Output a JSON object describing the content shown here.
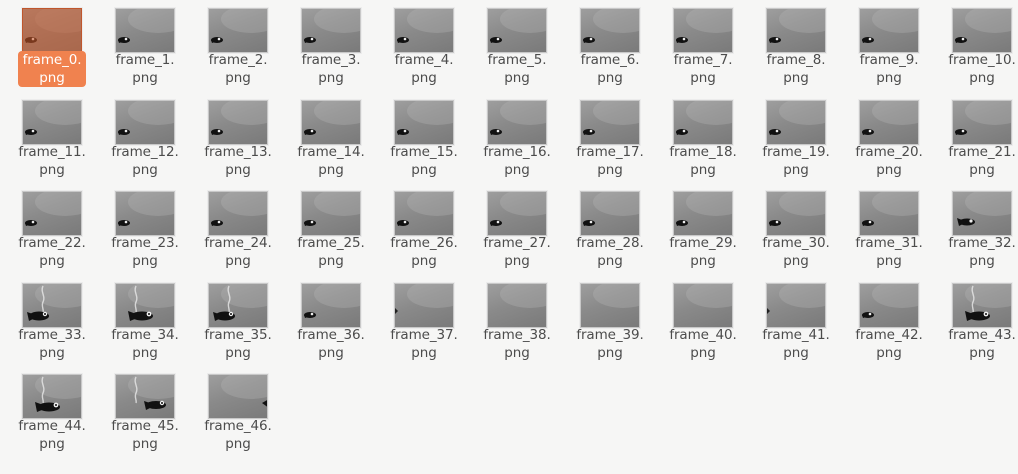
{
  "files": [
    {
      "name": "frame_0.",
      "ext": "png",
      "bird": "small-left",
      "selected": true
    },
    {
      "name": "frame_1.",
      "ext": "png",
      "bird": "small-left"
    },
    {
      "name": "frame_2.",
      "ext": "png",
      "bird": "small-left"
    },
    {
      "name": "frame_3.",
      "ext": "png",
      "bird": "small-left"
    },
    {
      "name": "frame_4.",
      "ext": "png",
      "bird": "small-left"
    },
    {
      "name": "frame_5.",
      "ext": "png",
      "bird": "small-left"
    },
    {
      "name": "frame_6.",
      "ext": "png",
      "bird": "small-left"
    },
    {
      "name": "frame_7.",
      "ext": "png",
      "bird": "small-left"
    },
    {
      "name": "frame_8.",
      "ext": "png",
      "bird": "small-left"
    },
    {
      "name": "frame_9.",
      "ext": "png",
      "bird": "small-left"
    },
    {
      "name": "frame_10.",
      "ext": "png",
      "bird": "small-left"
    },
    {
      "name": "frame_11.",
      "ext": "png",
      "bird": "small-left"
    },
    {
      "name": "frame_12.",
      "ext": "png",
      "bird": "small-left"
    },
    {
      "name": "frame_13.",
      "ext": "png",
      "bird": "small-left"
    },
    {
      "name": "frame_14.",
      "ext": "png",
      "bird": "small-left"
    },
    {
      "name": "frame_15.",
      "ext": "png",
      "bird": "small-left"
    },
    {
      "name": "frame_16.",
      "ext": "png",
      "bird": "small-left"
    },
    {
      "name": "frame_17.",
      "ext": "png",
      "bird": "small-left"
    },
    {
      "name": "frame_18.",
      "ext": "png",
      "bird": "small-left"
    },
    {
      "name": "frame_19.",
      "ext": "png",
      "bird": "small-left"
    },
    {
      "name": "frame_20.",
      "ext": "png",
      "bird": "small-left"
    },
    {
      "name": "frame_21.",
      "ext": "png",
      "bird": "small-left"
    },
    {
      "name": "frame_22.",
      "ext": "png",
      "bird": "small-left"
    },
    {
      "name": "frame_23.",
      "ext": "png",
      "bird": "small-left"
    },
    {
      "name": "frame_24.",
      "ext": "png",
      "bird": "small-left"
    },
    {
      "name": "frame_25.",
      "ext": "png",
      "bird": "small-left"
    },
    {
      "name": "frame_26.",
      "ext": "png",
      "bird": "small-left"
    },
    {
      "name": "frame_27.",
      "ext": "png",
      "bird": "small-left"
    },
    {
      "name": "frame_28.",
      "ext": "png",
      "bird": "small-left"
    },
    {
      "name": "frame_29.",
      "ext": "png",
      "bird": "small-left"
    },
    {
      "name": "frame_30.",
      "ext": "png",
      "bird": "small-left"
    },
    {
      "name": "frame_31.",
      "ext": "png",
      "bird": "small-left"
    },
    {
      "name": "frame_32.",
      "ext": "png",
      "bird": "mid"
    },
    {
      "name": "frame_33.",
      "ext": "png",
      "bird": "large-left",
      "smoke": true
    },
    {
      "name": "frame_34.",
      "ext": "png",
      "bird": "large-mid",
      "smoke": true
    },
    {
      "name": "frame_35.",
      "ext": "png",
      "bird": "large-left",
      "smoke": true
    },
    {
      "name": "frame_36.",
      "ext": "png",
      "bird": "small-left"
    },
    {
      "name": "frame_37.",
      "ext": "png",
      "bird": "edge"
    },
    {
      "name": "frame_38.",
      "ext": "png",
      "bird": "none"
    },
    {
      "name": "frame_39.",
      "ext": "png",
      "bird": "none"
    },
    {
      "name": "frame_40.",
      "ext": "png",
      "bird": "none"
    },
    {
      "name": "frame_41.",
      "ext": "png",
      "bird": "edge"
    },
    {
      "name": "frame_42.",
      "ext": "png",
      "bird": "small-left"
    },
    {
      "name": "frame_43.",
      "ext": "png",
      "bird": "large-mid",
      "smoke": true
    },
    {
      "name": "frame_44.",
      "ext": "png",
      "bird": "large-mid",
      "smoke": true
    },
    {
      "name": "frame_45.",
      "ext": "png",
      "bird": "large-right",
      "smoke": true
    },
    {
      "name": "frame_46.",
      "ext": "png",
      "bird": "edge-right"
    }
  ],
  "colors": {
    "selection": "#f0824f",
    "selection_tint": "#d05a28",
    "label_text": "#4c4c4c",
    "background": "#f6f6f5"
  },
  "icons": {
    "thumbnail": "image-thumbnail-icon"
  }
}
